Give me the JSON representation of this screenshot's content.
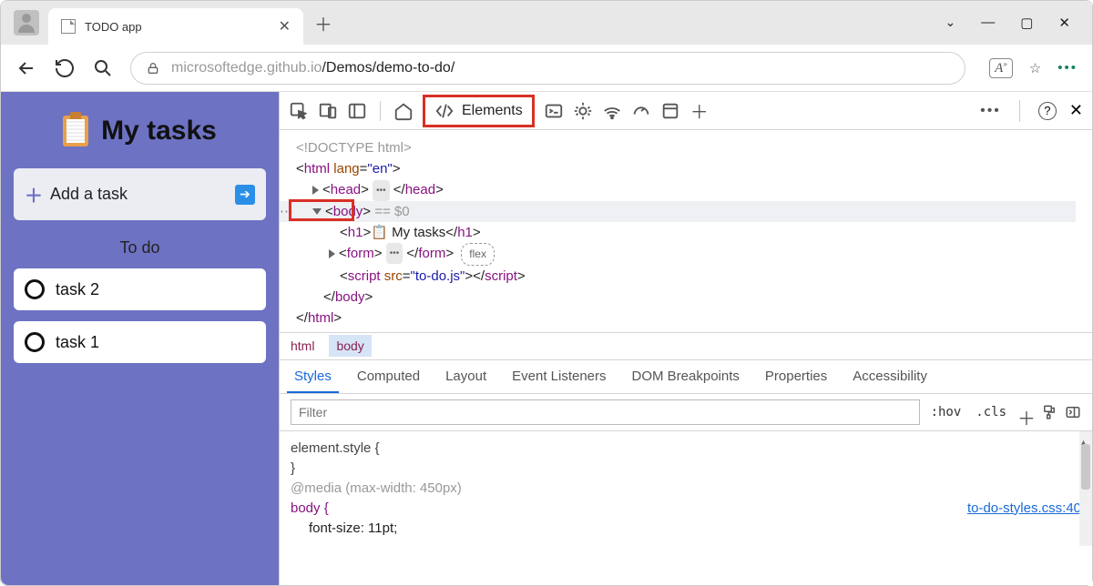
{
  "browser": {
    "tab_title": "TODO app",
    "url_host": "microsoftedge.github.io",
    "url_path": "/Demos/demo-to-do/"
  },
  "app": {
    "heading": "My tasks",
    "add_placeholder": "Add a task",
    "section": "To do",
    "tasks": [
      "task 2",
      "task 1"
    ]
  },
  "devtools": {
    "active_tab": "Elements",
    "dom": {
      "doctype": "<!DOCTYPE html>",
      "html_open": "html",
      "html_lang_attr": "lang",
      "html_lang_val": "\"en\"",
      "head": "head",
      "body": "body",
      "eq0": " == $0",
      "h1": "h1",
      "h1_text": " My tasks",
      "form": "form",
      "flex": "flex",
      "script": "script",
      "script_src_attr": "src",
      "script_src_val": "\"to-do.js\""
    },
    "breadcrumb": [
      "html",
      "body"
    ],
    "subtabs": [
      "Styles",
      "Computed",
      "Layout",
      "Event Listeners",
      "DOM Breakpoints",
      "Properties",
      "Accessibility"
    ],
    "filter_placeholder": "Filter",
    "hov": ":hov",
    "cls": ".cls",
    "styles": {
      "element_style": "element.style {",
      "close": "}",
      "media": "@media (max-width: 450px)",
      "body_sel": "body {",
      "prop1": "font-size: 11pt;",
      "link": "to-do-styles.css:40"
    }
  }
}
